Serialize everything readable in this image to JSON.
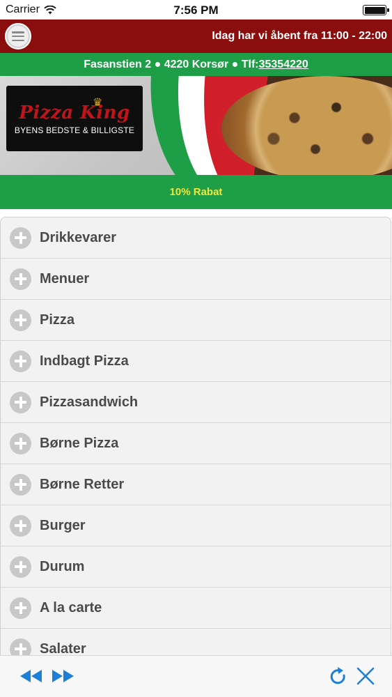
{
  "status_bar": {
    "carrier": "Carrier",
    "time": "7:56 PM"
  },
  "header": {
    "opening_hours": "Idag har vi åbent fra 11:00 - 22:00"
  },
  "address": {
    "text": "Fasanstien 2 ● 4220 Korsør ● Tlf:",
    "phone": "35354220"
  },
  "banner": {
    "logo_title": "Pizza King",
    "logo_subtitle": "BYENS BEDSTE & BILLIGSTE"
  },
  "discount": {
    "label": "10% Rabat"
  },
  "categories": [
    {
      "label": "Drikkevarer"
    },
    {
      "label": "Menuer"
    },
    {
      "label": "Pizza"
    },
    {
      "label": "Indbagt Pizza"
    },
    {
      "label": "Pizzasandwich"
    },
    {
      "label": "Børne Pizza"
    },
    {
      "label": "Børne Retter"
    },
    {
      "label": "Burger"
    },
    {
      "label": "Durum"
    },
    {
      "label": "A la carte"
    },
    {
      "label": "Salater"
    }
  ],
  "toolbar": {
    "back_icon": "back-icon",
    "forward_icon": "forward-icon",
    "reload_icon": "reload-icon",
    "close_icon": "close-icon"
  },
  "colors": {
    "header_red": "#8b0e0e",
    "brand_green": "#1f9e48",
    "discount_yellow": "#f3e63a",
    "toolbar_blue": "#1e7fd6"
  }
}
